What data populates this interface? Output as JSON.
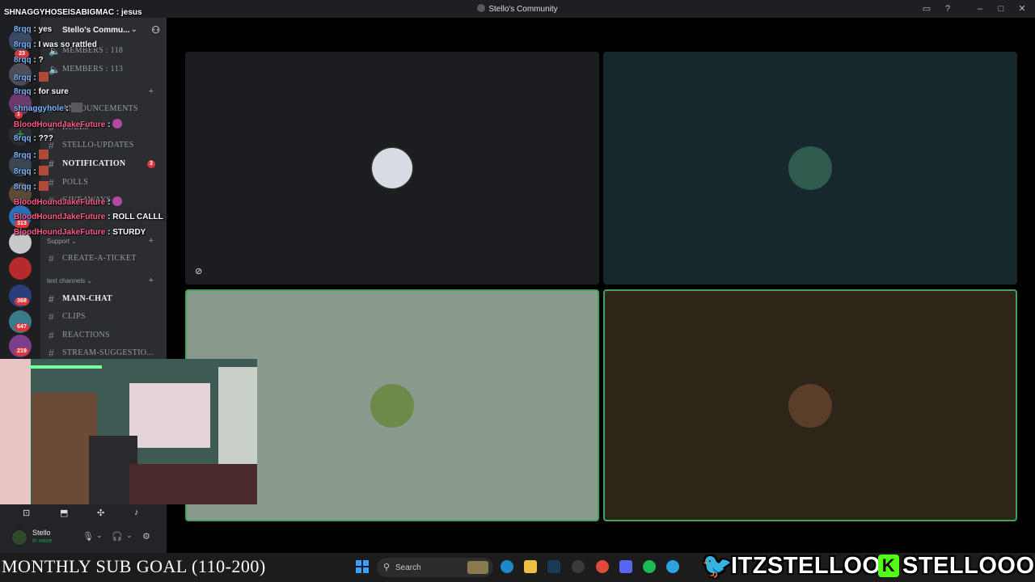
{
  "window": {
    "title": "Stello's Community"
  },
  "rail": {
    "badges": [
      "23",
      "1",
      "313",
      "368",
      "647",
      "219"
    ]
  },
  "sidebar": {
    "server_name": "Stello's Commu...",
    "members_items": [
      "MEMBERS : 118",
      "MEMBERS : 113"
    ],
    "channels": [
      {
        "label": "ANNOUNCEMENTS"
      },
      {
        "label": "ROLES"
      },
      {
        "label": "STELLO-UPDATES"
      },
      {
        "label": "NOTIFICATION",
        "unread": "3"
      },
      {
        "label": "POLLS"
      },
      {
        "label": "GIVEAWAYS"
      }
    ],
    "support_category": "Support",
    "support_channels": [
      {
        "label": "CREATE-A-TICKET"
      }
    ],
    "text_category": "text channels",
    "text_channels": [
      {
        "label": "MAIN-CHAT"
      },
      {
        "label": "CLIPS"
      },
      {
        "label": "REACTIONS"
      },
      {
        "label": "STREAM-SUGGESTIO..."
      }
    ]
  },
  "user_panel": {
    "name": "Stello",
    "status": "In voice"
  },
  "chat_overlay": [
    {
      "user": "SHNAGGYHOSEISABIGMAC",
      "sep": " : ",
      "text": "jesus"
    },
    {
      "user": "8rqq",
      "sep": " : ",
      "text": "yes"
    },
    {
      "user": "8rqq",
      "sep": " : ",
      "text": "I was so rattled"
    },
    {
      "user": "8rqq",
      "sep": " : ",
      "text": "?"
    },
    {
      "user": "8rqq",
      "sep": " : ",
      "text": ""
    },
    {
      "user": "8rqq",
      "sep": " : ",
      "text": "for sure"
    },
    {
      "user": "shnaggyhole",
      "sep": " : ",
      "text": ""
    },
    {
      "user": "BloodHoundJakeFuture",
      "sep": " : ",
      "text": ""
    },
    {
      "user": "8rqq",
      "sep": " : ",
      "text": "???"
    },
    {
      "user": "8rqq",
      "sep": " : ",
      "text": ""
    },
    {
      "user": "8rqq",
      "sep": " : ",
      "text": ""
    },
    {
      "user": "8rqq",
      "sep": " : ",
      "text": ""
    },
    {
      "user": "BloodHoundJakeFuture",
      "sep": " : ",
      "text": ""
    },
    {
      "user": "BloodHoundJakeFuture",
      "sep": " : ",
      "text": "ROLL CALLL"
    },
    {
      "user": "BloodHoundJakeFuture",
      "sep": " : ",
      "text": "STURDY"
    }
  ],
  "taskbar": {
    "goal_text": "MONTHLY SUB GOAL (110-200)",
    "search_label": "Search",
    "twitter_handle": "ITZSTELLOO",
    "kick_letter": "K",
    "kick_handle": "STELLOOO"
  },
  "colors": {
    "tile_top_left": "#1c1d21",
    "tile_top_right": "#17282c",
    "tile_bottom_left": "#8a9a8c",
    "tile_bottom_right": "#2e2519",
    "speaking_border": "#3ba55c"
  }
}
